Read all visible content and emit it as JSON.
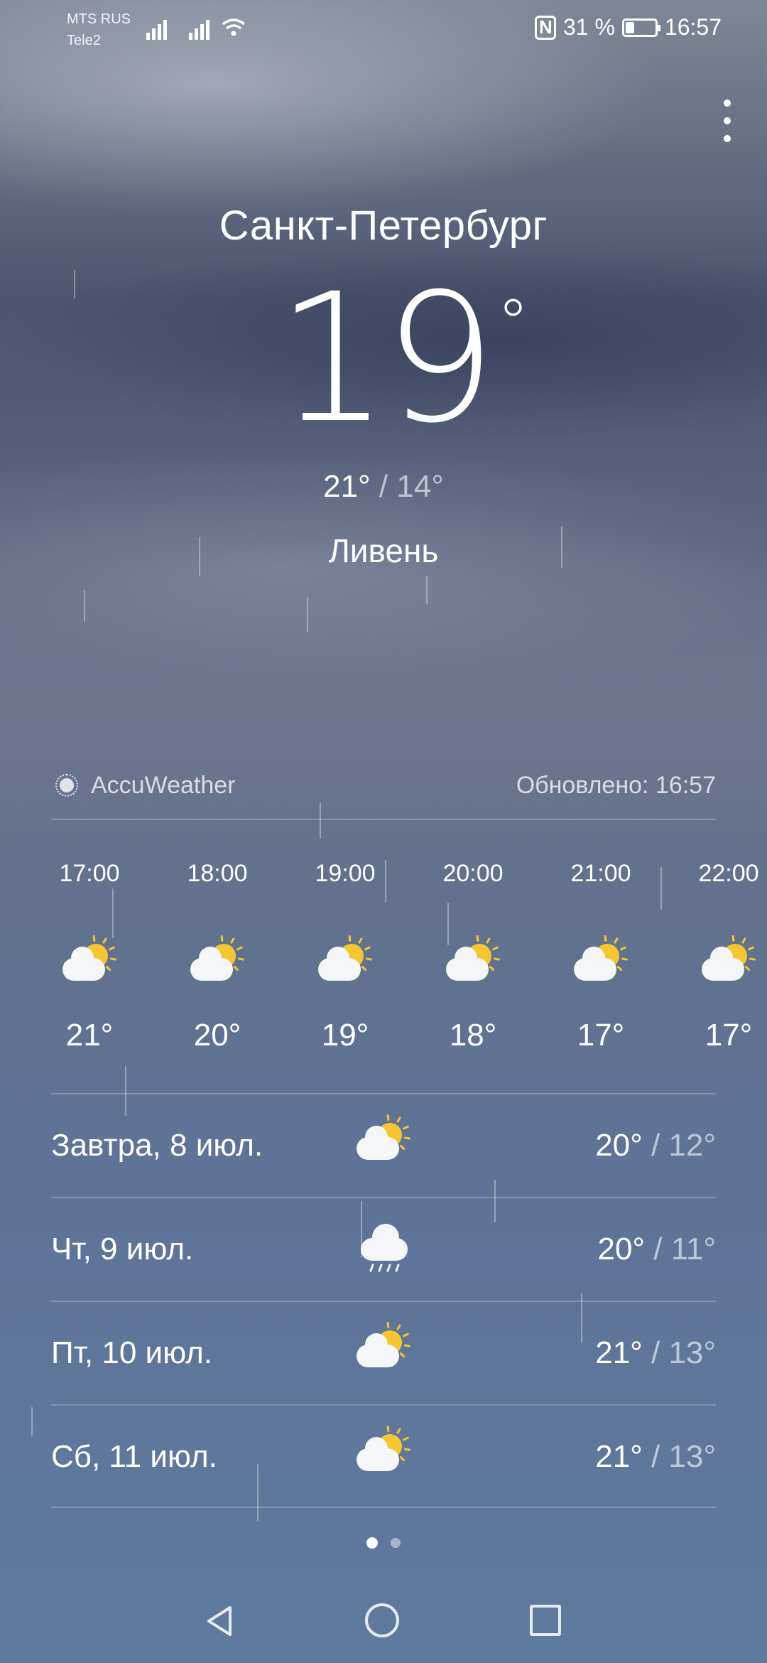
{
  "status_bar": {
    "carrier1": "MTS RUS",
    "carrier2": "Tele2",
    "battery_text": "31 %",
    "battery_level": 0.31,
    "time": "16:57"
  },
  "weather": {
    "city": "Санкт-Петербург",
    "temp": "19",
    "temp_unit": "°",
    "high": "21°",
    "separator": "/",
    "low": "14°",
    "condition": "Ливень"
  },
  "source": {
    "provider": "AccuWeather",
    "updated": "Обновлено: 16:57"
  },
  "hourly": [
    {
      "time": "17:00",
      "temp": "21°",
      "icon": "partly-cloudy-icon"
    },
    {
      "time": "18:00",
      "temp": "20°",
      "icon": "partly-cloudy-icon"
    },
    {
      "time": "19:00",
      "temp": "19°",
      "icon": "partly-cloudy-icon"
    },
    {
      "time": "20:00",
      "temp": "18°",
      "icon": "partly-cloudy-icon"
    },
    {
      "time": "21:00",
      "temp": "17°",
      "icon": "partly-cloudy-icon"
    },
    {
      "time": "22:00",
      "temp": "17°",
      "icon": "partly-cloudy-icon"
    }
  ],
  "daily": [
    {
      "day": "Завтра, 8 июл.",
      "high": "20°",
      "low": "12°",
      "icon": "partly-cloudy-icon"
    },
    {
      "day": "Чт, 9 июл.",
      "high": "20°",
      "low": "11°",
      "icon": "rain-icon"
    },
    {
      "day": "Пт, 10 июл.",
      "high": "21°",
      "low": "13°",
      "icon": "partly-cloudy-icon"
    },
    {
      "day": "Сб, 11 июл.",
      "high": "21°",
      "low": "13°",
      "icon": "partly-cloudy-icon"
    }
  ],
  "pager": {
    "pages": 2,
    "active": 1
  },
  "colors": {
    "sun": "#f6c632",
    "cloud": "#f4f6f8"
  }
}
